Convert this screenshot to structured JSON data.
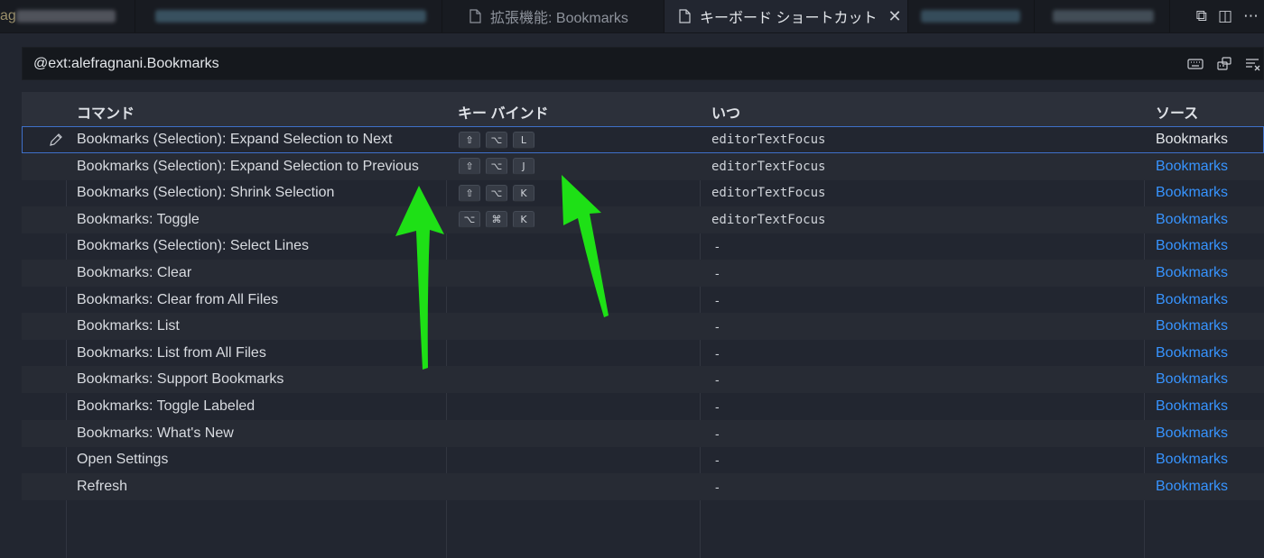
{
  "tabs": [
    {
      "label": "拡張機能: Bookmarks",
      "active": false
    },
    {
      "label": "キーボード ショートカット",
      "active": true
    }
  ],
  "tabbar_actions": [
    "split-editor-icon",
    "open-file-icon",
    "more-icon"
  ],
  "tabbar_action_glyphs": [
    "⧉",
    "◫",
    "⋯"
  ],
  "search": {
    "value": "@ext:alefragnani.Bookmarks"
  },
  "columns": {
    "command": "コマンド",
    "keybinding": "キー バインド",
    "when": "いつ",
    "source": "ソース"
  },
  "rows": [
    {
      "command": "Bookmarks (Selection): Expand Selection to Next",
      "keys": [
        "⇧",
        "⌥",
        "L"
      ],
      "when": "editorTextFocus",
      "source": "Bookmarks",
      "focused": true
    },
    {
      "command": "Bookmarks (Selection): Expand Selection to Previous",
      "keys": [
        "⇧",
        "⌥",
        "J"
      ],
      "when": "editorTextFocus",
      "source": "Bookmarks"
    },
    {
      "command": "Bookmarks (Selection): Shrink Selection",
      "keys": [
        "⇧",
        "⌥",
        "K"
      ],
      "when": "editorTextFocus",
      "source": "Bookmarks"
    },
    {
      "command": "Bookmarks: Toggle",
      "keys": [
        "⌥",
        "⌘",
        "K"
      ],
      "when": "editorTextFocus",
      "source": "Bookmarks"
    },
    {
      "command": "Bookmarks (Selection): Select Lines",
      "keys": [],
      "when": "-",
      "source": "Bookmarks"
    },
    {
      "command": "Bookmarks: Clear",
      "keys": [],
      "when": "-",
      "source": "Bookmarks"
    },
    {
      "command": "Bookmarks: Clear from All Files",
      "keys": [],
      "when": "-",
      "source": "Bookmarks"
    },
    {
      "command": "Bookmarks: List",
      "keys": [],
      "when": "-",
      "source": "Bookmarks"
    },
    {
      "command": "Bookmarks: List from All Files",
      "keys": [],
      "when": "-",
      "source": "Bookmarks"
    },
    {
      "command": "Bookmarks: Support Bookmarks",
      "keys": [],
      "when": "-",
      "source": "Bookmarks"
    },
    {
      "command": "Bookmarks: Toggle Labeled",
      "keys": [],
      "when": "-",
      "source": "Bookmarks"
    },
    {
      "command": "Bookmarks: What's New",
      "keys": [],
      "when": "-",
      "source": "Bookmarks"
    },
    {
      "command": "Open Settings",
      "keys": [],
      "when": "-",
      "source": "Bookmarks"
    },
    {
      "command": "Refresh",
      "keys": [],
      "when": "-",
      "source": "Bookmarks"
    }
  ],
  "colors": {
    "link": "#3794ff",
    "focus_border": "#3f70c9",
    "annotation_arrow": "#1ee016"
  }
}
